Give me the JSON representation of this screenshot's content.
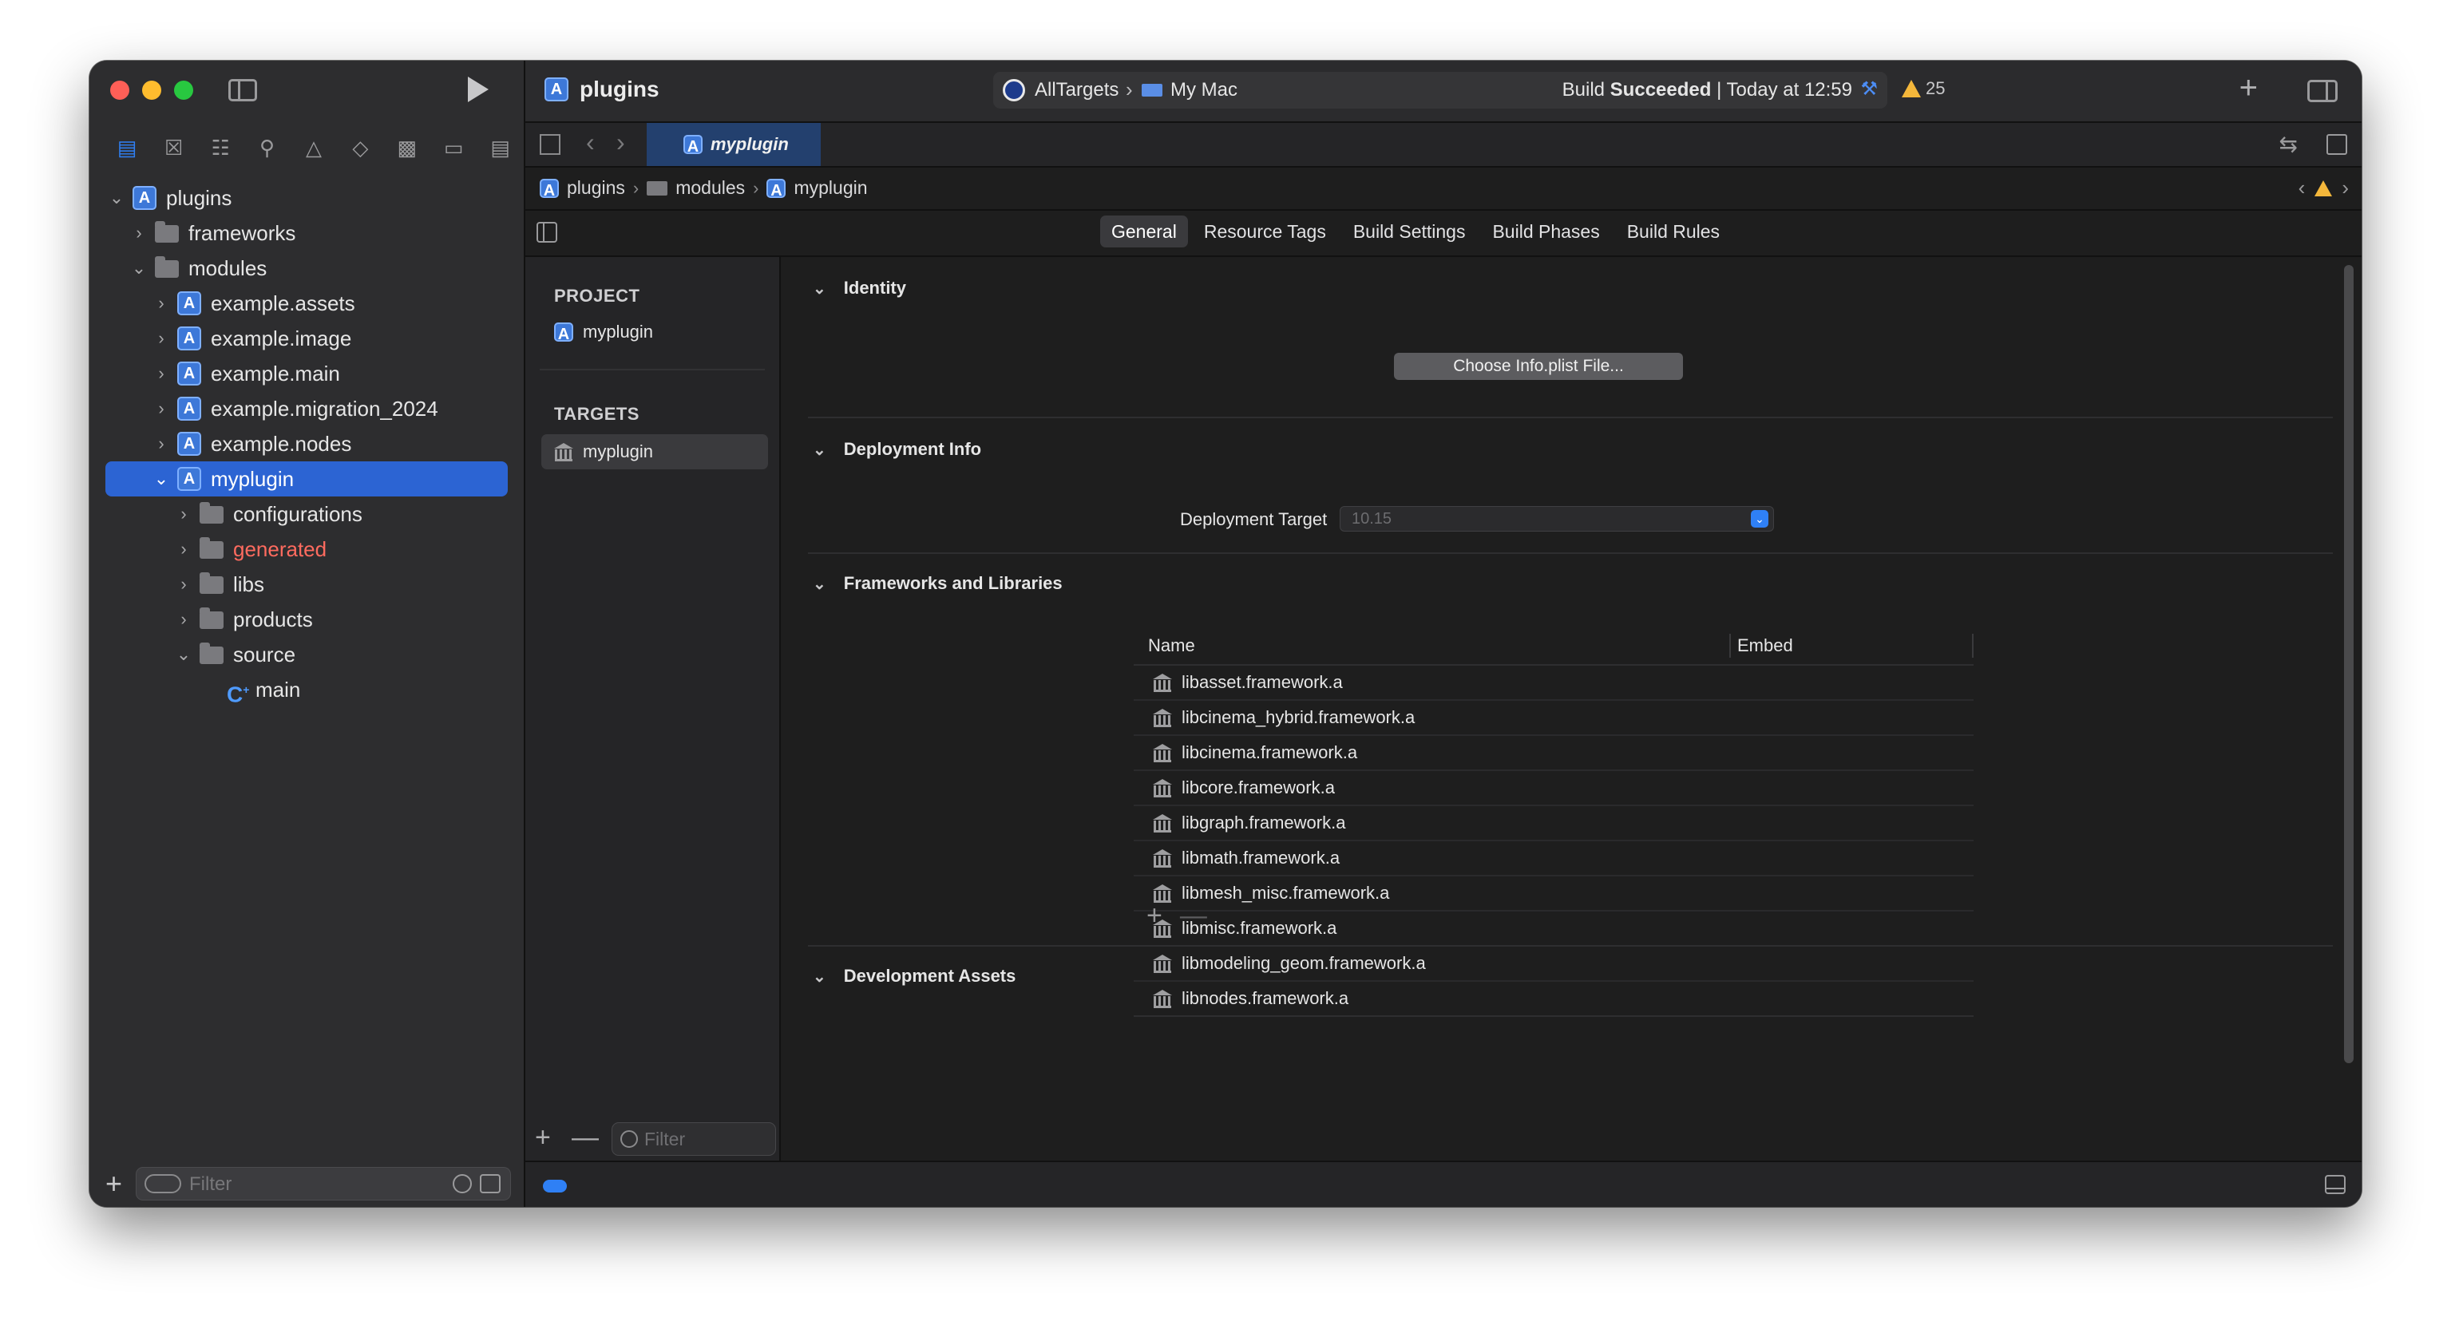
{
  "window": {
    "project_name": "plugins"
  },
  "navigator_tabs": [
    "project-navigator",
    "source-control-navigator",
    "symbol-navigator",
    "find-navigator",
    "issue-navigator",
    "test-navigator",
    "debug-navigator",
    "breakpoint-navigator",
    "report-navigator"
  ],
  "tree": [
    {
      "label": "plugins",
      "type": "project",
      "chevron": "v"
    },
    {
      "label": "frameworks",
      "type": "folder",
      "chevron": ">"
    },
    {
      "label": "modules",
      "type": "folder",
      "chevron": "v"
    },
    {
      "label": "example.assets",
      "type": "project",
      "chevron": ">"
    },
    {
      "label": "example.image",
      "type": "project",
      "chevron": ">"
    },
    {
      "label": "example.main",
      "type": "project",
      "chevron": ">"
    },
    {
      "label": "example.migration_2024",
      "type": "project",
      "chevron": ">"
    },
    {
      "label": "example.nodes",
      "type": "project",
      "chevron": ">"
    },
    {
      "label": "myplugin",
      "type": "project",
      "chevron": "v"
    },
    {
      "label": "configurations",
      "type": "folder",
      "chevron": ">"
    },
    {
      "label": "generated",
      "type": "folder",
      "chevron": ">",
      "color": "#ff6b5f"
    },
    {
      "label": "libs",
      "type": "folder",
      "chevron": ">"
    },
    {
      "label": "products",
      "type": "folder",
      "chevron": ">"
    },
    {
      "label": "source",
      "type": "folder",
      "chevron": "v"
    },
    {
      "label": "main",
      "type": "file",
      "chevron": ""
    }
  ],
  "sidebar_filter_placeholder": "Filter",
  "scheme": {
    "target": "AllTargets",
    "destination": "My Mac",
    "status_prefix": "Build ",
    "status_bold": "Succeeded",
    "status_suffix": " | Today at 12:59"
  },
  "warnings_count": "25",
  "active_tab": "myplugin",
  "breadcrumb": [
    "plugins",
    "modules",
    "myplugin"
  ],
  "editor_tabs": [
    "General",
    "Resource Tags",
    "Build Settings",
    "Build Phases",
    "Build Rules"
  ],
  "active_editor_tab": "General",
  "project_list": {
    "project_header": "PROJECT",
    "project_item": "myplugin",
    "targets_header": "TARGETS",
    "target_item": "myplugin",
    "filter_placeholder": "Filter"
  },
  "sections": {
    "identity": "Identity",
    "choose_plist": "Choose Info.plist File...",
    "deployment_info": "Deployment Info",
    "deployment_target_label": "Deployment Target",
    "deployment_target_value": "10.15",
    "frameworks": "Frameworks and Libraries",
    "development_assets": "Development Assets"
  },
  "frameworks_table": {
    "col_name": "Name",
    "col_embed": "Embed",
    "rows": [
      "libasset.framework.a",
      "libcinema_hybrid.framework.a",
      "libcinema.framework.a",
      "libcore.framework.a",
      "libgraph.framework.a",
      "libmath.framework.a",
      "libmesh_misc.framework.a",
      "libmisc.framework.a",
      "libmodeling_geom.framework.a",
      "libnodes.framework.a"
    ]
  },
  "colors": {
    "accent": "#2f80f5",
    "selection": "#2c64d3",
    "warning": "#f4b73b",
    "error_text": "#ff6b5f"
  }
}
